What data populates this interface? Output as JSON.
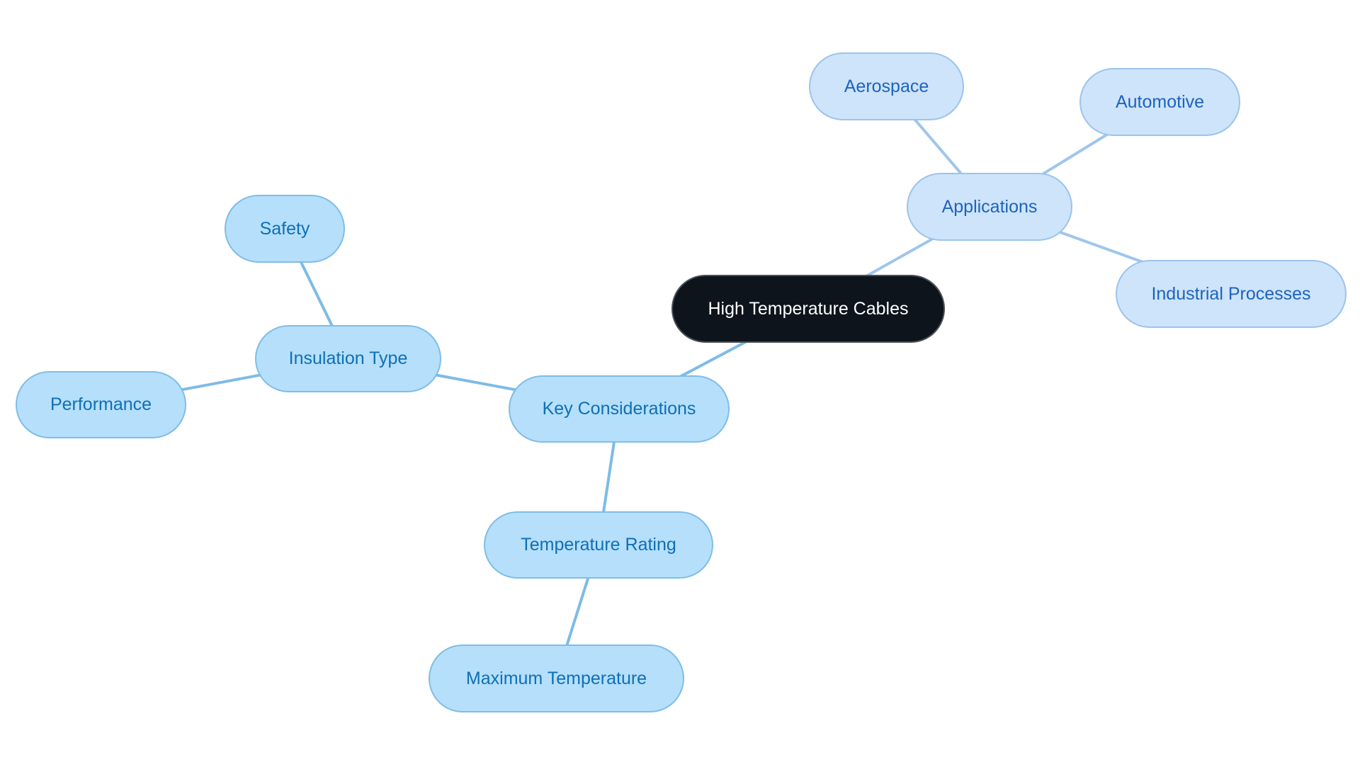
{
  "mindmap": {
    "title": "High Temperature Cables",
    "colors": {
      "root_fill": "#0d141b",
      "root_text": "#ffffff",
      "left_branch_fill": "#b5dffb",
      "left_branch_border": "#80bde6",
      "left_branch_text": "#0f6fb5",
      "left_branch_edge": "#7ebbe6",
      "right_branch_fill": "#cde4fa",
      "right_branch_border": "#9dc3ec",
      "right_branch_text": "#1e63bd",
      "right_branch_edge": "#9fc6ec"
    },
    "nodes": {
      "root": "High Temperature Cables",
      "key_considerations": "Key Considerations",
      "insulation_type": "Insulation Type",
      "safety": "Safety",
      "performance": "Performance",
      "temperature_rating": "Temperature Rating",
      "maximum_temperature": "Maximum Temperature",
      "applications": "Applications",
      "aerospace": "Aerospace",
      "automotive": "Automotive",
      "industrial_processes": "Industrial Processes"
    },
    "edges": [
      {
        "from": "root",
        "to": "key_considerations",
        "branch": "left"
      },
      {
        "from": "key_considerations",
        "to": "insulation_type",
        "branch": "left"
      },
      {
        "from": "insulation_type",
        "to": "safety",
        "branch": "left"
      },
      {
        "from": "insulation_type",
        "to": "performance",
        "branch": "left"
      },
      {
        "from": "key_considerations",
        "to": "temperature_rating",
        "branch": "left"
      },
      {
        "from": "temperature_rating",
        "to": "maximum_temperature",
        "branch": "left"
      },
      {
        "from": "root",
        "to": "applications",
        "branch": "right"
      },
      {
        "from": "applications",
        "to": "aerospace",
        "branch": "right"
      },
      {
        "from": "applications",
        "to": "automotive",
        "branch": "right"
      },
      {
        "from": "applications",
        "to": "industrial_processes",
        "branch": "right"
      }
    ]
  }
}
